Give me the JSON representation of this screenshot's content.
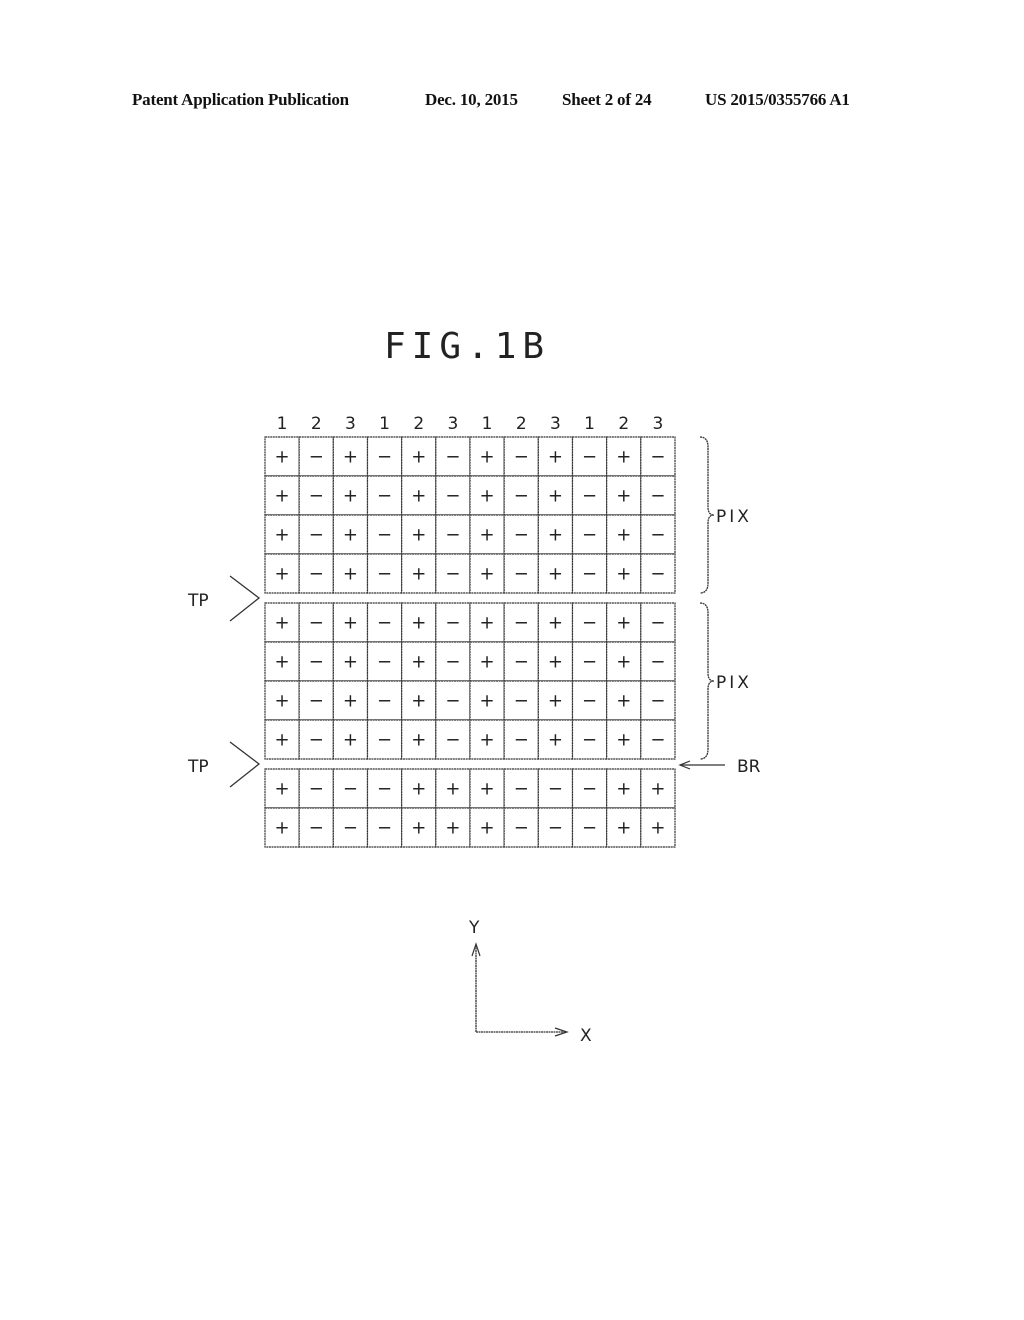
{
  "header": {
    "publication": "Patent Application Publication",
    "date": "Dec. 10, 2015",
    "sheet": "Sheet 2 of 24",
    "number": "US 2015/0355766 A1"
  },
  "figure": {
    "title": "FIG.1B",
    "column_labels": [
      "1",
      "2",
      "3",
      "1",
      "2",
      "3",
      "1",
      "2",
      "3",
      "1",
      "2",
      "3"
    ],
    "blocks": [
      {
        "name": "pixel-block-1",
        "label": "PIX",
        "rows": [
          [
            "+",
            "−",
            "+",
            "−",
            "+",
            "−",
            "+",
            "−",
            "+",
            "−",
            "+",
            "−"
          ],
          [
            "+",
            "−",
            "+",
            "−",
            "+",
            "−",
            "+",
            "−",
            "+",
            "−",
            "+",
            "−"
          ],
          [
            "+",
            "−",
            "+",
            "−",
            "+",
            "−",
            "+",
            "−",
            "+",
            "−",
            "+",
            "−"
          ],
          [
            "+",
            "−",
            "+",
            "−",
            "+",
            "−",
            "+",
            "−",
            "+",
            "−",
            "+",
            "−"
          ]
        ]
      },
      {
        "name": "pixel-block-2",
        "label": "PIX",
        "rows": [
          [
            "+",
            "−",
            "+",
            "−",
            "+",
            "−",
            "+",
            "−",
            "+",
            "−",
            "+",
            "−"
          ],
          [
            "+",
            "−",
            "+",
            "−",
            "+",
            "−",
            "+",
            "−",
            "+",
            "−",
            "+",
            "−"
          ],
          [
            "+",
            "−",
            "+",
            "−",
            "+",
            "−",
            "+",
            "−",
            "+",
            "−",
            "+",
            "−"
          ],
          [
            "+",
            "−",
            "+",
            "−",
            "+",
            "−",
            "+",
            "−",
            "+",
            "−",
            "+",
            "−"
          ]
        ]
      },
      {
        "name": "boundary-row-block",
        "label": "",
        "rows": [
          [
            "+",
            "−",
            "−",
            "−",
            "+",
            "+",
            "+",
            "−",
            "−",
            "−",
            "+",
            "+"
          ],
          [
            "+",
            "−",
            "−",
            "−",
            "+",
            "+",
            "+",
            "−",
            "−",
            "−",
            "+",
            "+"
          ]
        ]
      }
    ],
    "tp_labels": [
      "TP",
      "TP"
    ],
    "br_label": "BR",
    "axes": {
      "y_label": "Y",
      "x_label": "X"
    }
  }
}
